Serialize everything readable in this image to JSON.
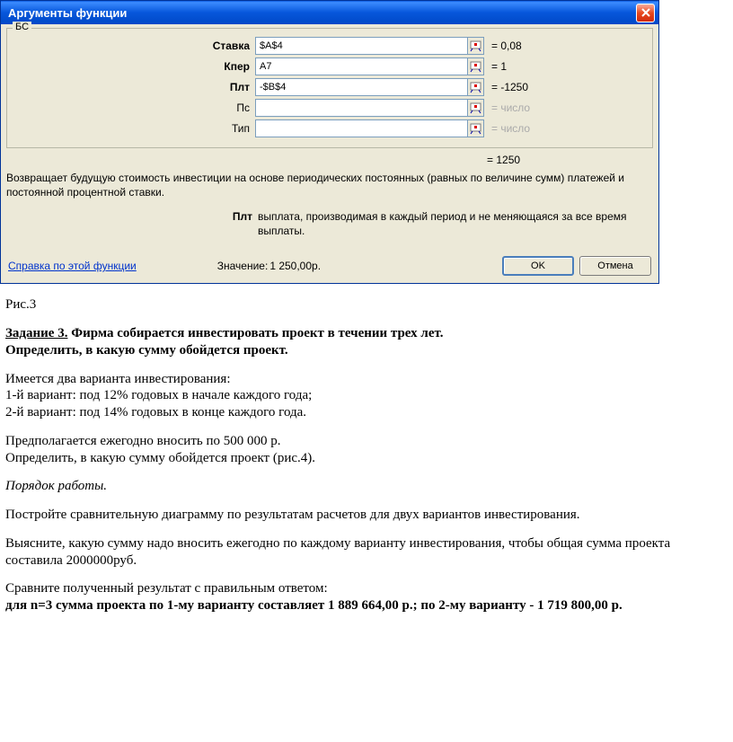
{
  "dialog": {
    "title": "Аргументы функции",
    "function_name": "БС",
    "args": [
      {
        "label": "Ставка",
        "bold": true,
        "value": "$A$4",
        "result": "= 0,08",
        "grey": false
      },
      {
        "label": "Кпер",
        "bold": true,
        "value": "A7",
        "result": "= 1",
        "grey": false
      },
      {
        "label": "Плт",
        "bold": true,
        "value": "-$B$4",
        "result": "= -1250",
        "grey": false
      },
      {
        "label": "Пс",
        "bold": false,
        "value": "",
        "result": "= число",
        "grey": true
      },
      {
        "label": "Тип",
        "bold": false,
        "value": "",
        "result": "= число",
        "grey": true
      }
    ],
    "computed": "= 1250",
    "description": "Возвращает будущую стоимость инвестиции на основе периодических постоянных (равных по величине сумм) платежей и постоянной процентной ставки.",
    "param_help": {
      "name": "Плт",
      "text": "выплата, производимая в каждый период и не меняющаяся за все время выплаты."
    },
    "help_link": "Справка по этой функции",
    "value_label": "Значение:",
    "value": "1 250,00р.",
    "ok": "OK",
    "cancel": "Отмена"
  },
  "doc": {
    "fig": "Рис.3",
    "task_label": "Задание 3.",
    "task_title": " Фирма собирается инвестировать проект в течении трех лет.",
    "task_line2": "Определить, в какую сумму обойдется проект.",
    "p1": "Имеется два варианта инвестирования:",
    "p1a": "1-й вариант: под 12% годовых в начале каждого года;",
    "p1b": "2-й вариант: под 14% годовых в конце каждого года.",
    "p2": "Предполагается ежегодно вносить по 500 000 р.",
    "p2a": "Определить, в какую сумму обойдется проект (рис.4).",
    "p3": "Порядок работы.",
    "p4": "Постройте сравнительную диаграмму по результатам расчетов для двух вариантов инвестирования.",
    "p5": "Выясните, какую сумму надо вносить ежегодно по каждому варианту инвестирования, чтобы общая сумма проекта составила 2000000руб.",
    "p6": "Сравните полученный результат с правильным ответом:",
    "p6b": "для n=3 сумма проекта по 1-му варианту составляет 1 889 664,00 р.; по 2-му варианту - 1 719 800,00 р."
  }
}
